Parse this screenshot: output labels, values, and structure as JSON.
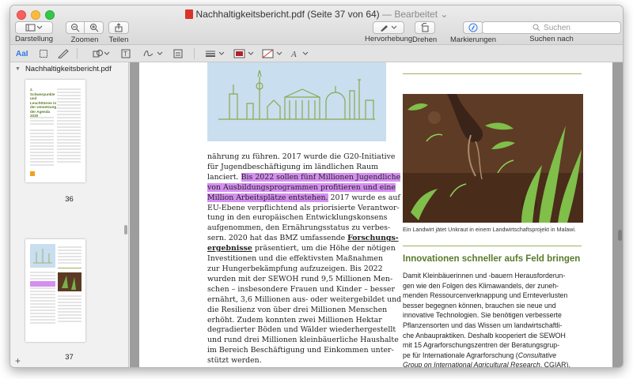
{
  "window": {
    "title": "Nachhaltigkeitsbericht.pdf (Seite 37 von 64)",
    "edited": "— Bearbeitet",
    "edited_chevron": "⌄"
  },
  "toolbar": {
    "view_label": "Darstellung",
    "zoom_label": "Zoomen",
    "share_label": "Teilen",
    "highlight_label": "Hervorhebung",
    "rotate_label": "Drehen",
    "markup_label": "Markierungen",
    "search_placeholder": "Suchen",
    "search_label": "Suchen nach"
  },
  "markup": {
    "text_tool": "AaI"
  },
  "sidebar": {
    "file_name": "Nachhaltigkeitsbericht.pdf",
    "thumb1": {
      "number": "36",
      "heading": "2. Schwerpunkte und Leuchttürme in der Umsetzung der Agenda 2030"
    },
    "thumb2": {
      "number": "37"
    }
  },
  "document": {
    "col1_lines": [
      "nährung zu führen. 2017 wurde die G20-Initiative",
      "für Jugendbeschäftigung im ländlichen Raum",
      "lanciert.",
      "Bis 2022 sollen fünf Millionen Jugendliche",
      "von Ausbildungsprogrammen profitieren und eine",
      "Million Arbeitsplätze entstehen.",
      "2017 wurde es auf",
      "EU-Ebene verpflichtend als priorisierte Verantwor-",
      "tung in den europäischen Entwicklungskonsens",
      "aufgenommen, den Ernährungsstatus zu verbes-",
      "sern. 2020 hat das BMZ umfassende",
      "Forschungs-",
      "ergebnisse",
      "präsentiert, um die Höhe der nötigen",
      "Investitionen und die effektivsten Maßnahmen",
      "zur Hungerbekämpfung aufzuzeigen. Bis 2022",
      "wurden mit der SEWOH rund 9,5 Millionen Men-",
      "schen – insbesondere Frauen und Kinder – besser",
      "ernährt, 3,6 Millionen aus- oder weitergebildet und",
      "die Resilienz von über drei Millionen Menschen",
      "erhöht. Zudem konnten zwei Millionen Hektar",
      "degradierter Böden und Wälder wiederhergestellt",
      "und rund drei Millionen kleinbäuerliche Haushalte",
      "im Bereich Beschäftigung und Einkommen unter-",
      "stützt werden."
    ],
    "caption": "Ein Landwirt jätet Unkraut in einem Landwirtschaftsprojekt in Malawi.",
    "heading": "Innovationen schneller aufs Feld bringen",
    "col2_lines": [
      "Damit Kleinbäuerinnen und -bauern Herausforderun-",
      "gen wie den Folgen des Klimawandels, der zuneh-",
      "menden Ressourcenverknappung und Ernteverlusten",
      "besser begegnen können, brauchen sie neue und",
      "innovative Technologien. Sie benötigen verbesserte",
      "Pflanzensorten und das Wissen um landwirtschaftli-",
      "che Anbaupraktiken. Deshalb kooperiert die SEWOH",
      "mit 15 Agrarforschungszentren der Beratungsgrup-",
      "pe für Internationale Agrarforschung (",
      "Consultative",
      "Group on International Agricultural Research",
      ", CGIAR)."
    ]
  },
  "colors": {
    "highlight": "#d58ff0",
    "heading_green": "#5a7a2a",
    "skyline_bg": "#c9deef"
  }
}
